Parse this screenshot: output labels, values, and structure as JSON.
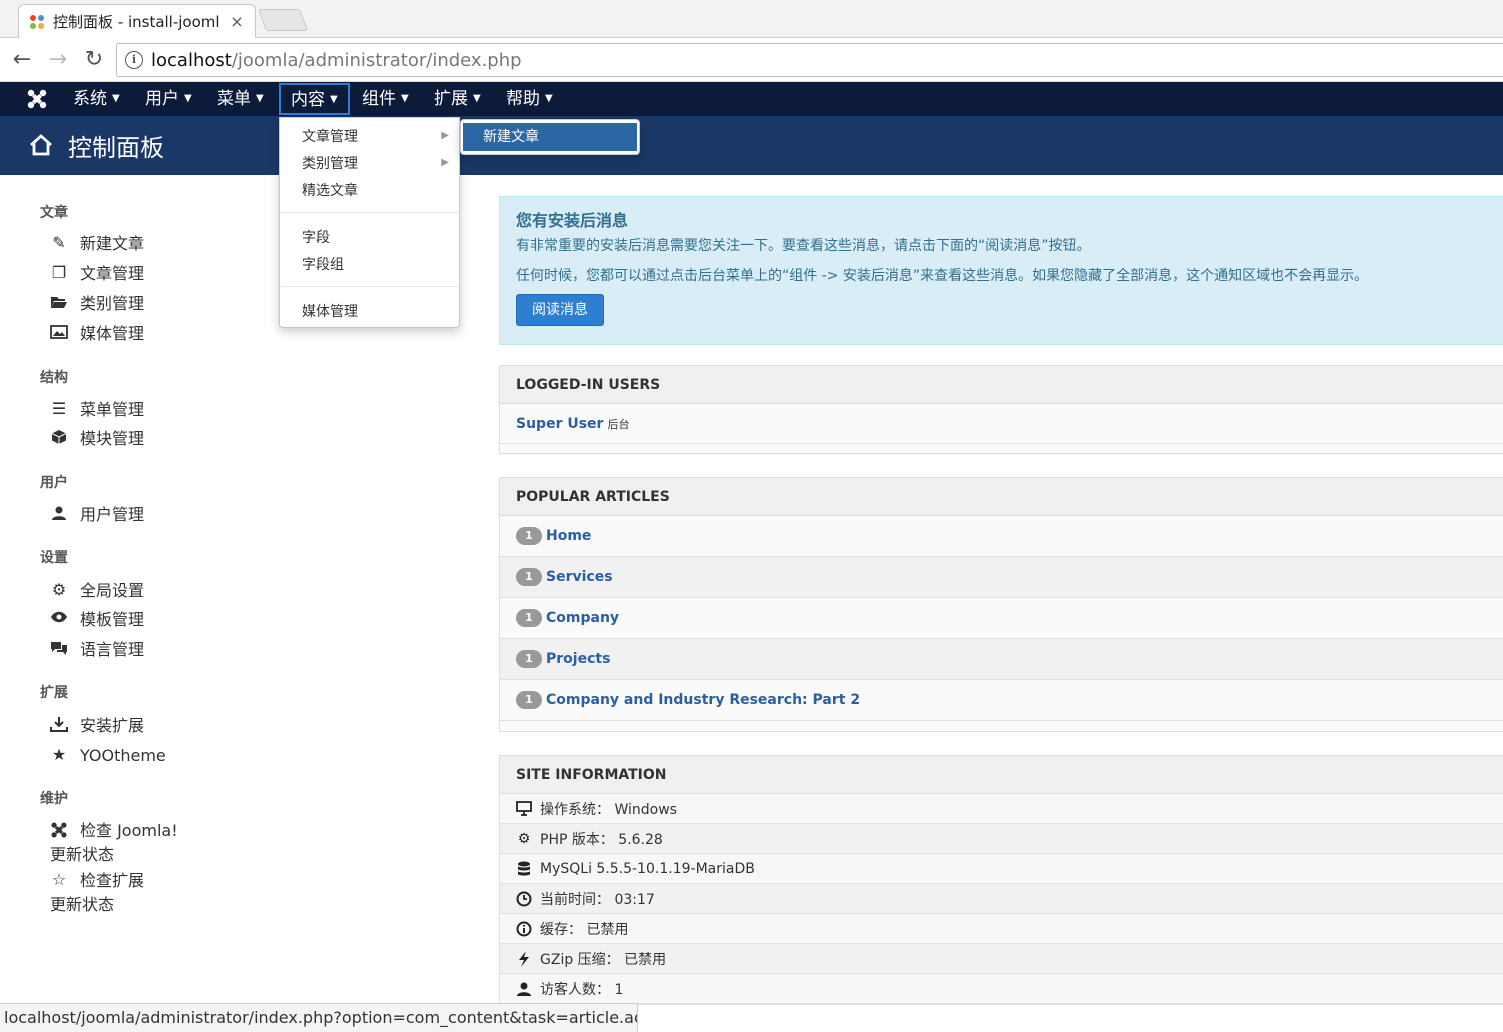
{
  "browser": {
    "tab_title": "控制面板 - install-jooml",
    "tab_close": "×",
    "url_host": "localhost",
    "url_path": "/joomla/administrator/index.php",
    "status_url": "localhost/joomla/administrator/index.php?option=com_content&task=article.add"
  },
  "topnav": {
    "items": [
      "系统",
      "用户",
      "菜单",
      "内容",
      "组件",
      "扩展",
      "帮助"
    ],
    "active": "内容"
  },
  "header": {
    "title": "控制面板"
  },
  "dropdown": {
    "items": [
      "文章管理",
      "类别管理",
      "精选文章",
      "字段",
      "字段组",
      "媒体管理"
    ],
    "submenu_item": "新建文章"
  },
  "sidebar": {
    "sections": [
      "文章",
      "结构",
      "用户",
      "设置",
      "扩展",
      "维护"
    ],
    "items": [
      "新建文章",
      "文章管理",
      "类别管理",
      "媒体管理",
      "菜单管理",
      "模块管理",
      "用户管理",
      "全局设置",
      "模板管理",
      "语言管理",
      "安装扩展",
      "YOOtheme",
      "检查 Joomla!",
      "更新状态",
      "检查扩展",
      "更新状态"
    ]
  },
  "message": {
    "title": "您有安装后消息",
    "line1": "有非常重要的安装后消息需要您关注一下。要查看这些消息，请点击下面的“阅读消息”按钮。",
    "line2": "任何时候，您都可以通过点击后台菜单上的“组件 -> 安装后消息”来查看这些消息。如果您隐藏了全部消息，这个通知区域也不会再显示。",
    "button": "阅读消息"
  },
  "logged_in": {
    "title": "LOGGED-IN USERS",
    "user": "Super User",
    "location": "后台"
  },
  "popular": {
    "title": "POPULAR ARTICLES",
    "articles": [
      {
        "count": "1",
        "title": "Home"
      },
      {
        "count": "1",
        "title": "Services"
      },
      {
        "count": "1",
        "title": "Company"
      },
      {
        "count": "1",
        "title": "Projects"
      },
      {
        "count": "1",
        "title": "Company and Industry Research: Part 2"
      }
    ]
  },
  "siteinfo": {
    "title": "SITE INFORMATION",
    "rows": [
      "操作系统： Windows",
      "PHP 版本： 5.6.28",
      "MySQLi 5.5.5-10.1.19-MariaDB",
      "当前时间： 03:17",
      "缓存： 已禁用",
      "GZip 压缩： 已禁用",
      "访客人数： 1"
    ]
  }
}
